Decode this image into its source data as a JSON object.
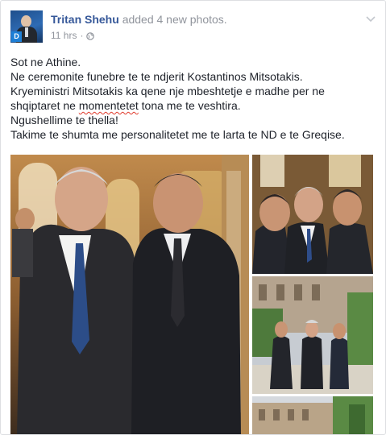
{
  "post": {
    "author": "Tritan Shehu",
    "action": "added 4 new photos.",
    "time": "11 hrs",
    "separator": "·",
    "privacy_icon": "globe-icon",
    "menu_icon": "chevron-down-icon",
    "avatar_badge": "D",
    "text": {
      "line1": "Sot ne Athine.",
      "line2": "Ne ceremonite funebre te te ndjerit Kostantinos Mitsotakis.",
      "line3": "Kryeministri Mitsotakis ka qene nje mbeshtetje e madhe per ne",
      "line4_before": "shqiptaret ne ",
      "line4_misspelled": "momentetet",
      "line4_after": " tona me te veshtira.",
      "line5": "Ngushellime te thella!",
      "line6": "Takime te shumta me personalitetet me te larta te ND e te Greqise."
    }
  },
  "photos": {
    "count": 4
  },
  "colors": {
    "link": "#365899",
    "meta": "#90949c",
    "text": "#1d2129",
    "spellcheck": "#e0392b"
  }
}
